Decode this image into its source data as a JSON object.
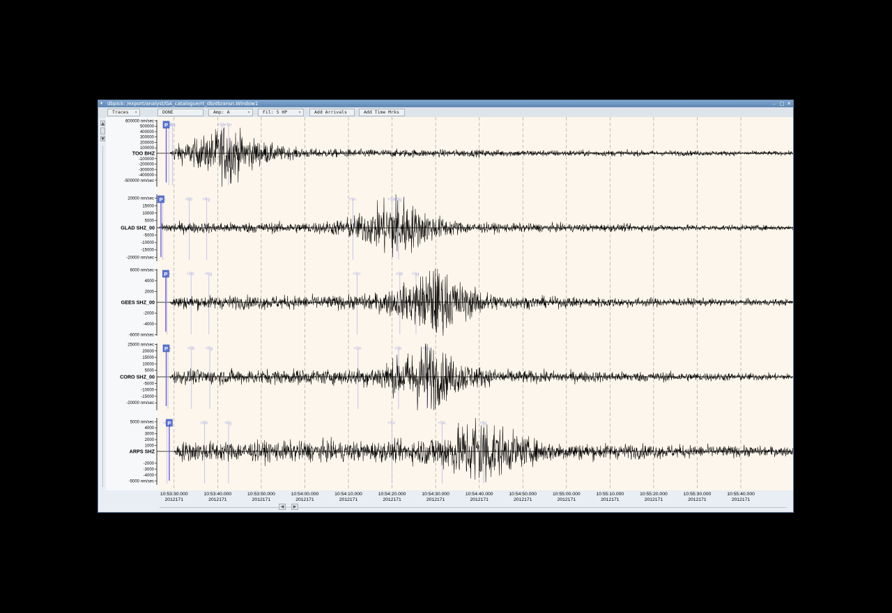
{
  "window": {
    "title": "dbpick: /export/analyst/GA_catalogue/rt_db/db/ansn.Window1",
    "minimize_glyph": "–",
    "maximize_glyph": "□",
    "close_glyph": "✕",
    "menu_glyph": "▾"
  },
  "toolbar": {
    "traces": "Traces",
    "status": "DONE",
    "amp": "Amp: A",
    "filter": "Fil: 5 HP",
    "add_arrivals": "Add Arrivals",
    "add_time_marks": "Add Time Mrks",
    "dropdown_glyph": "▿"
  },
  "scrollbar": {
    "up": "▲",
    "down": "▼",
    "left": "◀",
    "right": "▶"
  },
  "colors": {
    "plot_bg": "#fdf6ec",
    "trace": "#000000",
    "pick_P": "#6b5be6",
    "phase_label": "#aab0e8",
    "grid": "#9a9a9a"
  },
  "chart_data": {
    "type": "seismogram",
    "x_tick_times": [
      "10:53:30.000",
      "10:53:40.000",
      "10:53:50.000",
      "10:54:00.000",
      "10:54:10.000",
      "10:54:20.000",
      "10:54:30.000",
      "10:54:40.000",
      "10:54:50.000",
      "10:55:00.000",
      "10:55:10.000",
      "10:55:20.000",
      "10:55:30.000",
      "10:55:40.000"
    ],
    "x_tick_date": "2012171",
    "x_tick_seconds": [
      30,
      40,
      50,
      60,
      70,
      80,
      90,
      100,
      110,
      120,
      130,
      140,
      150,
      160
    ],
    "x_range_seconds": [
      26.2,
      172.3
    ],
    "traces": [
      {
        "station": "TOO BHZ",
        "unit_label": "nm/sec",
        "yticks": [
          600000,
          500000,
          400000,
          300000,
          200000,
          100000,
          -100000,
          -200000,
          -300000,
          -400000,
          -500000
        ],
        "ylim": [
          -600000,
          600000
        ],
        "first_P_pick": 28.2,
        "phase_marks": [
          {
            "label": "Pb",
            "t": 28.8
          },
          {
            "label": "Pg",
            "t": 29.6
          },
          {
            "label": "Sb",
            "t": 41.0
          },
          {
            "label": "Sn",
            "t": 42.5
          }
        ],
        "signal_onset": 29.0,
        "peak_time": 42.0,
        "peak_amp": 0.78,
        "background_amp": 0.14
      },
      {
        "station": "GLAD SHZ_00",
        "unit_label": "nm/sec",
        "yticks": [
          20000,
          15000,
          10000,
          5000,
          -5000,
          -10000,
          -15000,
          -20000
        ],
        "ylim": [
          -22000,
          22000
        ],
        "first_P_pick": 27.0,
        "phase_marks": [
          {
            "label": "Pn",
            "t": 27.4
          },
          {
            "label": "Pb",
            "t": 33.5
          },
          {
            "label": "Pg",
            "t": 37.5
          },
          {
            "label": "Sn",
            "t": 71.0
          },
          {
            "label": "Sb",
            "t": 80.0
          },
          {
            "label": "Sg",
            "t": 81.5
          }
        ],
        "signal_onset": 26.5,
        "peak_time": 81.0,
        "peak_amp": 0.92,
        "background_amp": 0.16
      },
      {
        "station": "GEES SHZ_00",
        "unit_label": "nm/sec",
        "yticks": [
          6000,
          4000,
          2000,
          -2000,
          -4000,
          -6000
        ],
        "ylim": [
          -6000,
          6000
        ],
        "first_P_pick": 28.1,
        "phase_marks": [
          {
            "label": "Pn",
            "t": 28.4
          },
          {
            "label": "Pb",
            "t": 33.9
          },
          {
            "label": "Pg",
            "t": 38.0
          },
          {
            "label": "Sn",
            "t": 72.0
          },
          {
            "label": "Sb",
            "t": 81.8
          },
          {
            "label": "Sg",
            "t": 85.5
          }
        ],
        "signal_onset": 29.0,
        "peak_time": 90.0,
        "peak_amp": 0.95,
        "background_amp": 0.2
      },
      {
        "station": "CORO SHZ_00",
        "unit_label": "nm/sec",
        "yticks": [
          25000,
          20000,
          15000,
          10000,
          5000,
          -5000,
          -10000,
          -15000,
          -20000
        ],
        "ylim": [
          -25000,
          25000
        ],
        "first_P_pick": 28.2,
        "phase_marks": [
          {
            "label": "Pn",
            "t": 28.6
          },
          {
            "label": "Pb",
            "t": 34.0
          },
          {
            "label": "Pg",
            "t": 38.2
          },
          {
            "label": "Sn",
            "t": 72.2
          },
          {
            "label": "Sb",
            "t": 81.5
          },
          {
            "label": "Sg",
            "t": 88.0
          }
        ],
        "signal_onset": 29.0,
        "peak_time": 88.0,
        "peak_amp": 0.92,
        "background_amp": 0.22
      },
      {
        "station": "ARPS SHZ",
        "unit_label": "nm/sec",
        "yticks": [
          5000,
          4000,
          3000,
          2000,
          1000,
          -2000,
          -3000,
          -4000,
          -5000
        ],
        "ylim": [
          -5500,
          5500
        ],
        "first_P_pick": 28.9,
        "phase_marks": [
          {
            "label": "Pn",
            "t": 28.4
          },
          {
            "label": "Pb",
            "t": 37.0
          },
          {
            "label": "Pg",
            "t": 42.5
          },
          {
            "label": "Sn",
            "t": 80.0
          },
          {
            "label": "Sb",
            "t": 91.5
          },
          {
            "label": "Sg",
            "t": 101.0
          }
        ],
        "signal_onset": 30.0,
        "peak_time": 100.0,
        "peak_amp": 0.92,
        "background_amp": 0.3
      }
    ]
  }
}
